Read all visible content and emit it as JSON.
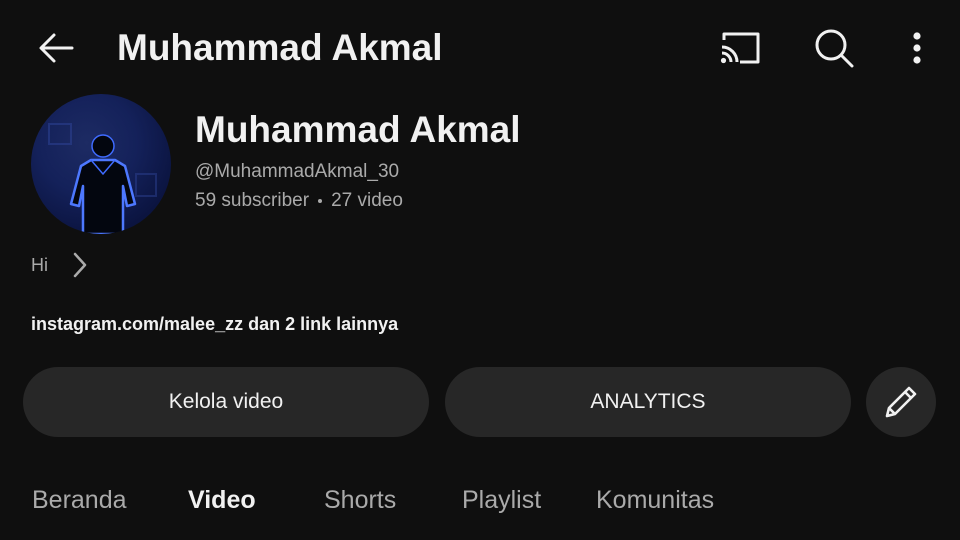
{
  "header": {
    "title": "Muhammad Akmal",
    "icons": [
      "back-arrow-icon",
      "cast-icon",
      "search-icon",
      "more-vert-icon"
    ]
  },
  "channel": {
    "name": "Muhammad Akmal",
    "handle": "@MuhammadAkmal_30",
    "subscribers": "59 subscriber",
    "videos": "27 video",
    "description": "Hi",
    "links": "instagram.com/malee_zz dan 2 link lainnya"
  },
  "actions": {
    "manage_label": "Kelola video",
    "analytics_label": "ANALYTICS",
    "edit_icon": "pencil-icon"
  },
  "tabs": [
    {
      "label": "Beranda",
      "active": false
    },
    {
      "label": "Video",
      "active": true
    },
    {
      "label": "Shorts",
      "active": false
    },
    {
      "label": "Playlist",
      "active": false
    },
    {
      "label": "Komunitas",
      "active": false
    }
  ],
  "colors": {
    "background": "#0f0f0f",
    "surface": "#272727",
    "text_primary": "#f1f1f1",
    "text_secondary": "#aaaaaa",
    "avatar_glow": "#3f6bff"
  }
}
